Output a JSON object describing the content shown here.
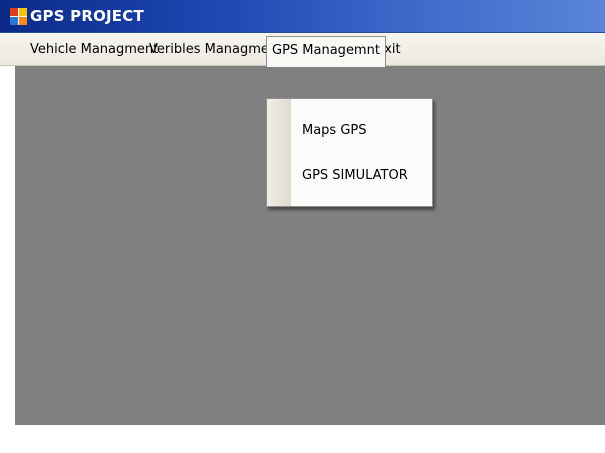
{
  "window": {
    "title": "GPS PROJECT",
    "icon": "app-grid-icon"
  },
  "menubar": {
    "items": [
      {
        "label": "Vehicle Managment"
      },
      {
        "label": "Veribles Managment"
      },
      {
        "label": "GPS Managemnt"
      },
      {
        "label": "Exit"
      }
    ],
    "open_menu": "GPS Managemnt"
  },
  "dropdown": {
    "items": [
      {
        "label": "Maps  GPS"
      },
      {
        "label": "GPS SIMULATOR"
      }
    ]
  },
  "colors": {
    "titlebar_start": "#0b2a86",
    "titlebar_end": "#5b85d8",
    "menubar_bg": "#ebe9df",
    "client_bg": "#808080"
  }
}
